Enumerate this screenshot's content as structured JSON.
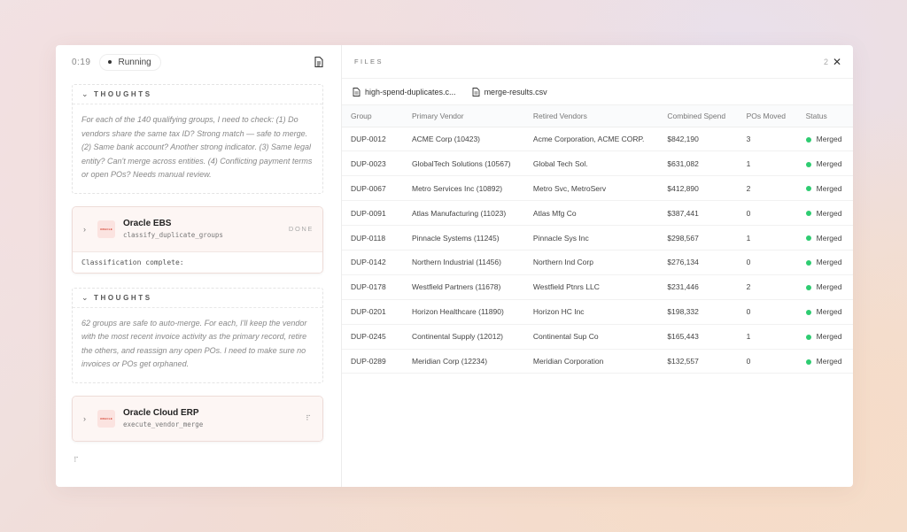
{
  "left_header": {
    "timer": "0:19",
    "status": "Running"
  },
  "thoughts": [
    {
      "title": "THOUGHTS",
      "text": "For each of the 140 qualifying groups, I need to check: (1) Do vendors share the same tax ID? Strong match — safe to merge. (2) Same bank account? Another strong indicator. (3) Same legal entity? Can't merge across entities. (4) Conflicting payment terms or open POs? Needs manual review."
    },
    {
      "title": "THOUGHTS",
      "text": "62 groups are safe to auto-merge. For each, I'll keep the vendor with the most recent invoice activity as the primary record, retire the others, and reassign any open POs. I need to make sure no invoices or POs get orphaned."
    }
  ],
  "tools": [
    {
      "name": "Oracle EBS",
      "function": "classify_duplicate_groups",
      "status": "DONE",
      "output": "Classification complete:"
    },
    {
      "name": "Oracle Cloud ERP",
      "function": "execute_vendor_merge",
      "status": ""
    }
  ],
  "files_panel": {
    "title": "FILES",
    "count": "2",
    "tabs": [
      "high-spend-duplicates.c...",
      "merge-results.csv"
    ]
  },
  "table": {
    "columns": [
      "Group",
      "Primary Vendor",
      "Retired Vendors",
      "Combined Spend",
      "POs Moved",
      "Status"
    ],
    "rows": [
      [
        "DUP-0012",
        "ACME Corp (10423)",
        "Acme Corporation, ACME CORP.",
        "$842,190",
        "3",
        "Merged"
      ],
      [
        "DUP-0023",
        "GlobalTech Solutions (10567)",
        "Global Tech Sol.",
        "$631,082",
        "1",
        "Merged"
      ],
      [
        "DUP-0067",
        "Metro Services Inc (10892)",
        "Metro Svc, MetroServ",
        "$412,890",
        "2",
        "Merged"
      ],
      [
        "DUP-0091",
        "Atlas Manufacturing (11023)",
        "Atlas Mfg Co",
        "$387,441",
        "0",
        "Merged"
      ],
      [
        "DUP-0118",
        "Pinnacle Systems (11245)",
        "Pinnacle Sys Inc",
        "$298,567",
        "1",
        "Merged"
      ],
      [
        "DUP-0142",
        "Northern Industrial (11456)",
        "Northern Ind Corp",
        "$276,134",
        "0",
        "Merged"
      ],
      [
        "DUP-0178",
        "Westfield Partners (11678)",
        "Westfield Ptnrs LLC",
        "$231,446",
        "2",
        "Merged"
      ],
      [
        "DUP-0201",
        "Horizon Healthcare (11890)",
        "Horizon HC Inc",
        "$198,332",
        "0",
        "Merged"
      ],
      [
        "DUP-0245",
        "Continental Supply (12012)",
        "Continental Sup Co",
        "$165,443",
        "1",
        "Merged"
      ],
      [
        "DUP-0289",
        "Meridian Corp (12234)",
        "Meridian Corporation",
        "$132,557",
        "0",
        "Merged"
      ]
    ]
  },
  "colors": {
    "merged": "#2ecc71",
    "oracle_red": "#d43b2a"
  }
}
